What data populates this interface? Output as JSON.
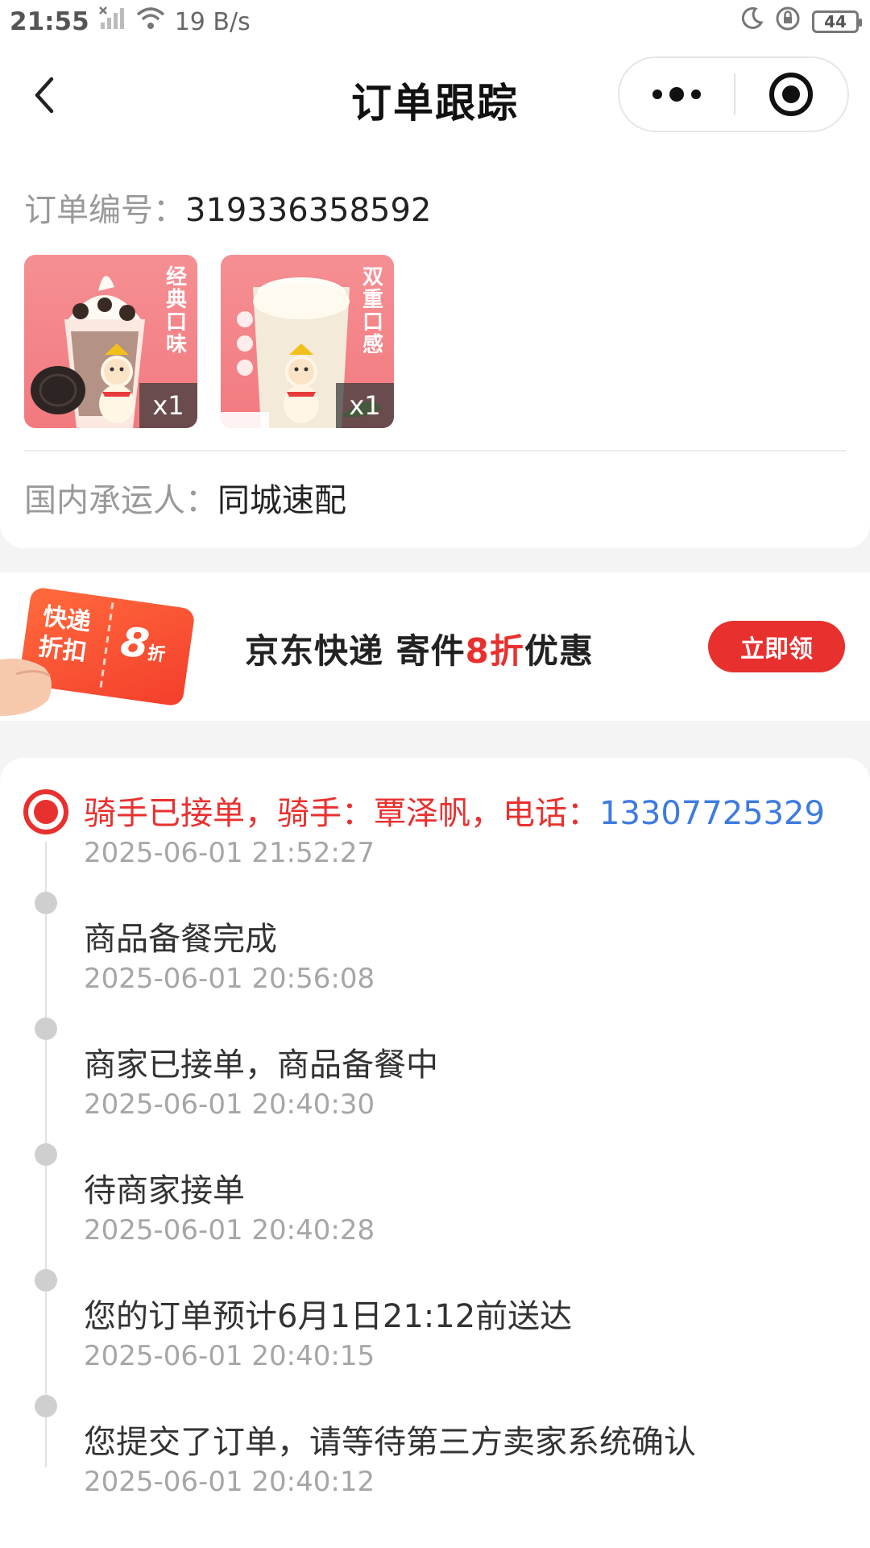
{
  "status_bar": {
    "time": "21:55",
    "net_speed": "19 B/s",
    "battery": "44",
    "icons": [
      "signal-off-icon",
      "wifi-icon",
      "moon-icon",
      "rotation-lock-icon",
      "battery-icon"
    ]
  },
  "nav": {
    "title": "订单跟踪",
    "icons": [
      "back-arrow-icon",
      "more-dots-icon",
      "target-icon"
    ]
  },
  "order": {
    "number_label": "订单编号：",
    "number": "319336358592",
    "products": [
      {
        "vertical_text": "经典口味",
        "qty": "x1",
        "icon": "sundae-product-image"
      },
      {
        "vertical_text": "双重口感",
        "qty": "x1",
        "icon": "milk-tea-product-image"
      }
    ],
    "carrier_label": "国内承运人：",
    "carrier": "同城速配"
  },
  "promo": {
    "ticket_text_line1": "快递",
    "ticket_text_line2": "折扣",
    "ticket_discount": "8",
    "ticket_discount_unit": "折",
    "text_before": "京东快递 寄件",
    "text_highlight": "8折",
    "text_after": "优惠",
    "button_label": "立即领"
  },
  "timeline": [
    {
      "title": "骑手已接单，骑手：覃泽帆，电话：",
      "phone": "13307725329",
      "time": "2025-06-01 21:52:27",
      "active": true
    },
    {
      "title": "商品备餐完成",
      "time": "2025-06-01 20:56:08",
      "active": false
    },
    {
      "title": "商家已接单，商品备餐中",
      "time": "2025-06-01 20:40:30",
      "active": false
    },
    {
      "title": "待商家接单",
      "time": "2025-06-01 20:40:28",
      "active": false
    },
    {
      "title": "您的订单预计6月1日21:12前送达",
      "time": "2025-06-01 20:40:15",
      "active": false
    },
    {
      "title": "您提交了订单，请等待第三方卖家系统确认",
      "time": "2025-06-01 20:40:12",
      "active": false
    }
  ],
  "colors": {
    "accent_red": "#e8312f",
    "link_blue": "#3d7be0",
    "muted_gray": "#a6a6a6"
  }
}
